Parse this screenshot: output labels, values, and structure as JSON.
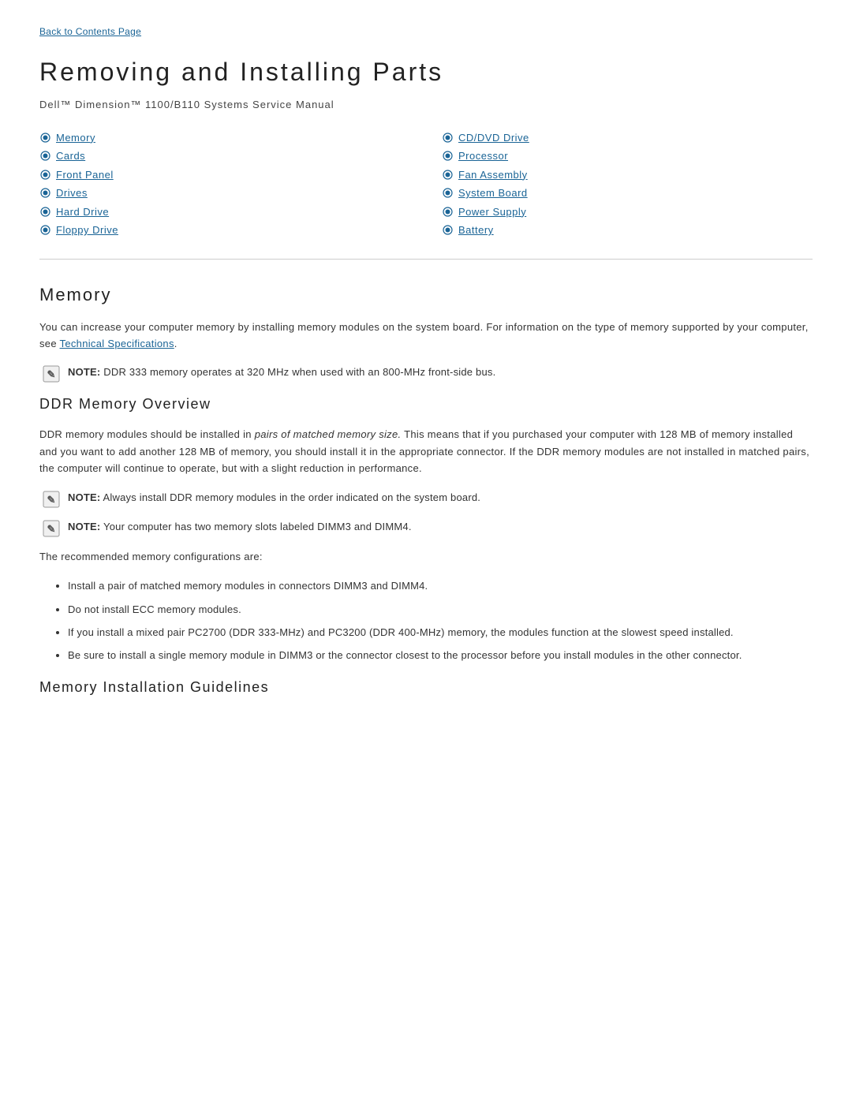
{
  "back_link": {
    "label": "Back to Contents Page"
  },
  "header": {
    "title": "Removing and Installing Parts",
    "subtitle": "Dell™ Dimension™ 1100/B110 Systems Service Manual"
  },
  "toc": {
    "left_items": [
      {
        "id": "memory",
        "label": "Memory"
      },
      {
        "id": "cards",
        "label": "Cards"
      },
      {
        "id": "front-panel",
        "label": "Front Panel"
      },
      {
        "id": "drives",
        "label": "Drives"
      },
      {
        "id": "hard-drive",
        "label": "Hard Drive"
      },
      {
        "id": "floppy-drive",
        "label": "Floppy Drive"
      }
    ],
    "right_items": [
      {
        "id": "cd-dvd-drive",
        "label": "CD/DVD Drive"
      },
      {
        "id": "processor",
        "label": "Processor"
      },
      {
        "id": "fan-assembly",
        "label": "Fan Assembly"
      },
      {
        "id": "system-board",
        "label": "System Board"
      },
      {
        "id": "power-supply",
        "label": "Power Supply"
      },
      {
        "id": "battery",
        "label": "Battery"
      }
    ]
  },
  "memory_section": {
    "title": "Memory",
    "intro": "You can increase your computer memory by installing memory modules on the system board. For information on the type of memory supported by your computer, see ",
    "link_text": "Technical Specifications",
    "intro_end": ".",
    "note1": {
      "label": "NOTE:",
      "text": " DDR 333 memory operates at 320 MHz when used with an 800-MHz front-side bus."
    }
  },
  "ddr_section": {
    "title": "DDR Memory Overview",
    "body": "DDR memory modules should be installed in pairs of matched memory size. This means that if you purchased your computer with 128 MB of memory installed and you want to add another 128 MB of memory, you should install it in the appropriate connector. If the DDR memory modules are not installed in matched pairs, the computer will continue to operate, but with a slight reduction in performance.",
    "note1": {
      "label": "NOTE:",
      "text": " Always install DDR memory modules in the order indicated on the system board."
    },
    "note2": {
      "label": "NOTE:",
      "text": " Your computer has two memory slots labeled DIMM3 and DIMM4."
    },
    "recommended_text": "The recommended memory configurations are:",
    "bullets": [
      "Install a pair of matched memory modules in connectors DIMM3 and DIMM4.",
      "Do not install ECC memory modules.",
      "If you install a mixed pair PC2700 (DDR 333-MHz) and PC3200 (DDR 400-MHz) memory, the modules function at the slowest speed installed.",
      "Be sure to install a single memory module in DIMM3 or the connector closest to the processor before you install modules in the other connector."
    ]
  },
  "installation_section": {
    "title": "Memory Installation Guidelines"
  }
}
